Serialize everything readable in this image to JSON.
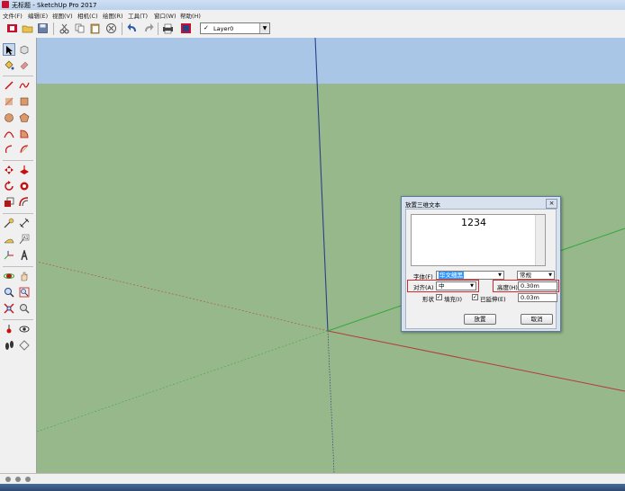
{
  "window": {
    "title": "无标题 - SketchUp Pro 2017"
  },
  "menu": [
    "文件(F)",
    "编辑(E)",
    "视图(V)",
    "相机(C)",
    "绘图(R)",
    "工具(T)",
    "窗口(W)",
    "帮助(H)"
  ],
  "toolbar": {
    "icons": [
      "get-models-icon",
      "open-file-icon",
      "save-icon",
      "cut-icon",
      "copy-icon",
      "paste-icon",
      "erase-icon",
      "undo-icon",
      "redo-icon",
      "print-icon",
      "model-info-icon"
    ],
    "layer": {
      "check": "✓",
      "value": "Layer0"
    }
  },
  "left_tools": [
    "select-tool-icon",
    "component-tool-icon",
    "paint-bucket-icon",
    "eraser-icon",
    "line-tool-icon",
    "freehand-tool-icon",
    "rectangle-tool-icon",
    "rotated-rectangle-icon",
    "circle-tool-icon",
    "polygon-tool-icon",
    "arc-tool-icon",
    "pie-tool-icon",
    "three-point-arc-icon",
    "two-point-arc-icon",
    "move-tool-icon",
    "push-pull-icon",
    "rotate-tool-icon",
    "follow-me-icon",
    "scale-tool-icon",
    "offset-tool-icon",
    "tape-measure-icon",
    "dimension-tool-icon",
    "protractor-icon",
    "text-tool-icon",
    "axes-tool-icon",
    "3d-text-icon",
    "orbit-tool-icon",
    "pan-tool-icon",
    "zoom-tool-icon",
    "zoom-window-icon",
    "zoom-extents-icon",
    "previous-view-icon",
    "position-camera-icon",
    "look-around-icon",
    "walk-tool-icon",
    "section-plane-icon"
  ],
  "viewport": {
    "sky_color": "#a9c6e6",
    "ground_color": "#97b88a",
    "red_axis": "#b53a3a",
    "green_axis": "#2fa83a",
    "blue_axis": "#2a3f8a"
  },
  "dialog": {
    "title": "放置三维文本",
    "close": "×",
    "text_value": "1234",
    "font_label": "字体(F)",
    "font_value": "华文细黑",
    "style_value": "常规",
    "align_label": "对齐(A)",
    "align_value": "中",
    "height_label": "高度(H)",
    "height_value": "0.30m",
    "form_label": "形状",
    "fill_label": "填充(I)",
    "extrude_label": "已延伸(E)",
    "extrude_value": "0.03m",
    "place_button": "放置",
    "cancel_button": "取消",
    "highlight_color": "#d42a2a"
  }
}
